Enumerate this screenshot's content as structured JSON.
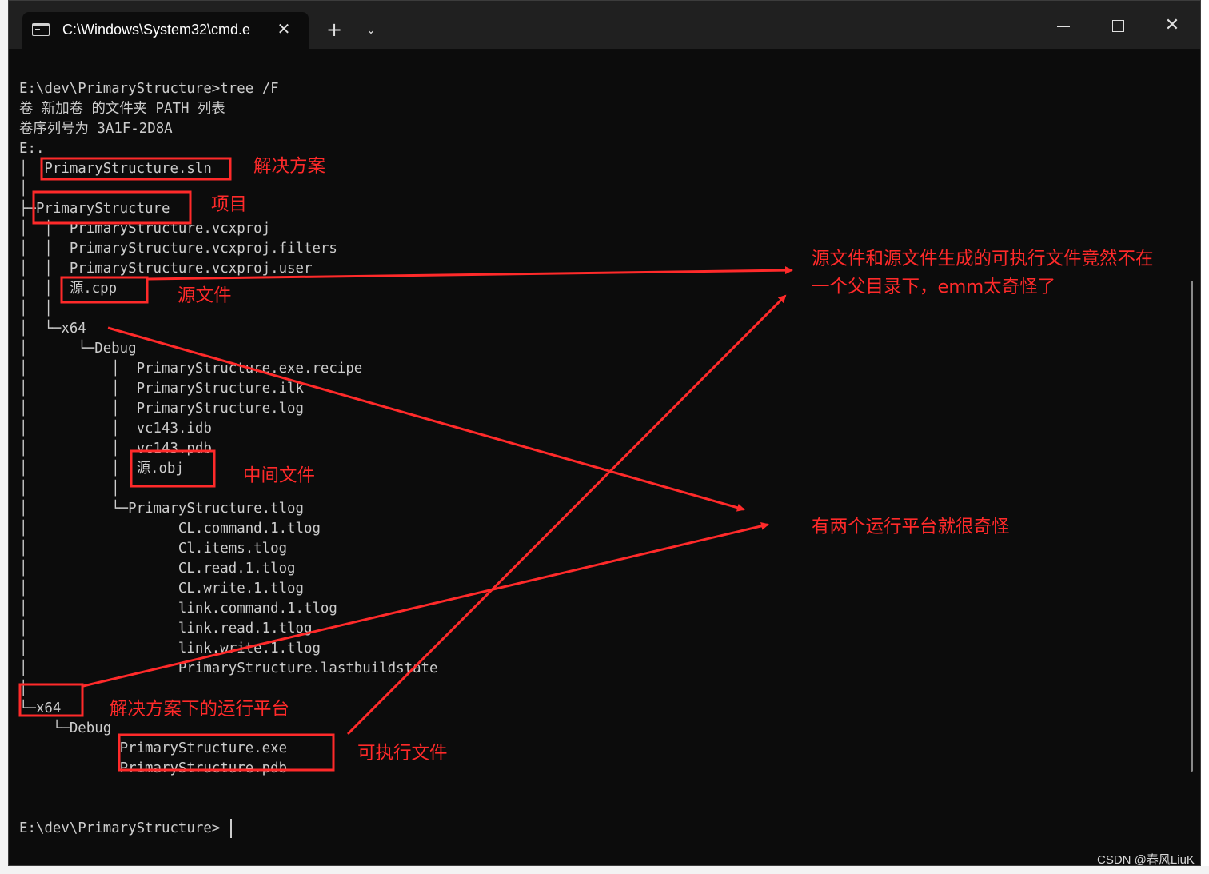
{
  "window": {
    "tab_title": "C:\\Windows\\System32\\cmd.e",
    "tab_close": "✕",
    "new_tab": "+",
    "dropdown": "⌄",
    "minimize": "",
    "maximize": "",
    "close": "✕"
  },
  "terminal": {
    "lines": [
      "E:\\dev\\PrimaryStructure>tree /F",
      "卷 新加卷 的文件夹 PATH 列表",
      "卷序列号为 3A1F-2D8A",
      "E:.",
      "│  PrimaryStructure.sln",
      "│",
      "├─PrimaryStructure",
      "│  │  PrimaryStructure.vcxproj",
      "│  │  PrimaryStructure.vcxproj.filters",
      "│  │  PrimaryStructure.vcxproj.user",
      "│  │  源.cpp",
      "│  │",
      "│  └─x64",
      "│      └─Debug",
      "│          │  PrimaryStructure.exe.recipe",
      "│          │  PrimaryStructure.ilk",
      "│          │  PrimaryStructure.log",
      "│          │  vc143.idb",
      "│          │  vc143.pdb",
      "│          │  源.obj",
      "│          │",
      "│          └─PrimaryStructure.tlog",
      "│                  CL.command.1.tlog",
      "│                  Cl.items.tlog",
      "│                  CL.read.1.tlog",
      "│                  CL.write.1.tlog",
      "│                  link.command.1.tlog",
      "│                  link.read.1.tlog",
      "│                  link.write.1.tlog",
      "│                  PrimaryStructure.lastbuildstate",
      "│",
      "└─x64",
      "    └─Debug",
      "            PrimaryStructure.exe",
      "            PrimaryStructure.pdb",
      "",
      "E:\\dev\\PrimaryStructure>"
    ]
  },
  "annotations": {
    "solution": "解决方案",
    "project": "项目",
    "source_file": "源文件",
    "intermediate_file": "中间文件",
    "solution_platform": "解决方案下的运行平台",
    "executable": "可执行文件",
    "note_line1": "源文件和源文件生成的可执行文件竟然不在",
    "note_line2": "一个父目录下，emm太奇怪了",
    "note_platforms": "有两个运行平台就很奇怪",
    "color": "#ff2a2a"
  },
  "watermark": "CSDN @春风LiuK",
  "colors": {
    "terminal_bg": "#0c0c0c",
    "titlebar_bg": "#202020",
    "text": "#cccccc",
    "annotation": "#ff2a2a"
  }
}
